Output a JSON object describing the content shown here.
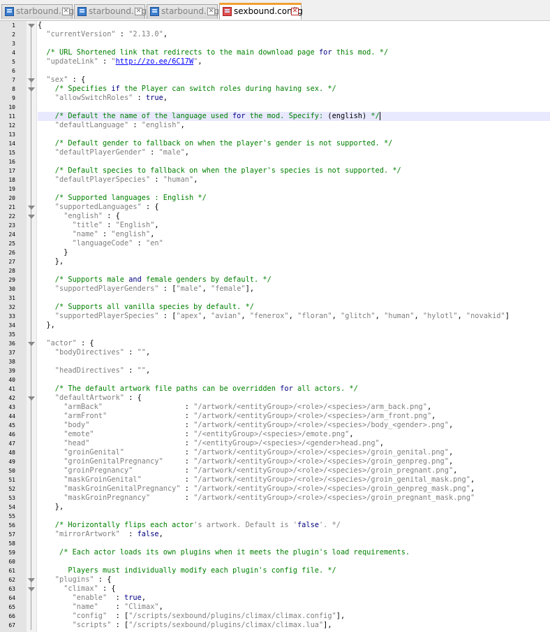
{
  "tabs": [
    {
      "label": "starbound.log",
      "active": false
    },
    {
      "label": "starbound.log",
      "active": false
    },
    {
      "label": "starbound.log",
      "active": false
    },
    {
      "label": "sexbound.config",
      "active": true
    }
  ],
  "close_glyph": "✕",
  "colors": {
    "comment": "#008000",
    "string": "#808080",
    "keyword": "#000080",
    "link": "#0000ff",
    "active_tab_accent": "#f0a030"
  },
  "editor": {
    "current_line": 11,
    "fold_lines": [
      1,
      7,
      8,
      21,
      22,
      36,
      42,
      62,
      63
    ],
    "lines": [
      {
        "n": "1",
        "parts": [
          [
            "pn",
            "{"
          ]
        ]
      },
      {
        "n": "2",
        "parts": [
          [
            "st",
            "  \"currentVersion\""
          ],
          [
            "pn",
            " : "
          ],
          [
            "st",
            "\"2.13.0\""
          ],
          [
            "pn",
            ","
          ]
        ]
      },
      {
        "n": "3",
        "parts": []
      },
      {
        "n": "4",
        "parts": [
          [
            "cm",
            "  /* URL Shortened link that redirects to the main download page "
          ],
          [
            "kw",
            "for"
          ],
          [
            "cm",
            " this mod. */"
          ]
        ]
      },
      {
        "n": "5",
        "parts": [
          [
            "st",
            "  \"updateLink\""
          ],
          [
            "pn",
            " : "
          ],
          [
            "st",
            "\""
          ],
          [
            "lk",
            "http://zo.ee/6C17W"
          ],
          [
            "st",
            "\""
          ],
          [
            "pn",
            ","
          ]
        ]
      },
      {
        "n": "6",
        "parts": []
      },
      {
        "n": "7",
        "parts": [
          [
            "st",
            "  \"sex\""
          ],
          [
            "pn",
            " : {"
          ]
        ]
      },
      {
        "n": "8",
        "parts": [
          [
            "cm",
            "    /* Specifies "
          ],
          [
            "kw",
            "if"
          ],
          [
            "cm",
            " the Player can switch roles during having sex. */"
          ]
        ]
      },
      {
        "n": "9",
        "parts": [
          [
            "st",
            "    \"allowSwitchRoles\""
          ],
          [
            "pn",
            " : "
          ],
          [
            "kw",
            "true"
          ],
          [
            "pn",
            ","
          ]
        ]
      },
      {
        "n": "10",
        "parts": []
      },
      {
        "n": "11",
        "parts": [
          [
            "cm",
            "    /* Default the name of the language used "
          ],
          [
            "kw",
            "for"
          ],
          [
            "cm",
            " the mod. Specify: "
          ],
          [
            "pn",
            "(english)"
          ],
          [
            "cm",
            " */"
          ]
        ]
      },
      {
        "n": "12",
        "parts": [
          [
            "st",
            "    \"defaultLanguage\""
          ],
          [
            "pn",
            " : "
          ],
          [
            "st",
            "\"english\""
          ],
          [
            "pn",
            ","
          ]
        ]
      },
      {
        "n": "13",
        "parts": []
      },
      {
        "n": "14",
        "parts": [
          [
            "cm",
            "    /* Default gender to fallback on when the player's gender is not supported. */"
          ]
        ]
      },
      {
        "n": "15",
        "parts": [
          [
            "st",
            "    \"defaultPlayerGender\""
          ],
          [
            "pn",
            " : "
          ],
          [
            "st",
            "\"male\""
          ],
          [
            "pn",
            ","
          ]
        ]
      },
      {
        "n": "16",
        "parts": []
      },
      {
        "n": "17",
        "parts": [
          [
            "cm",
            "    /* Default species to fallback on when the player's species is not supported. */"
          ]
        ]
      },
      {
        "n": "18",
        "parts": [
          [
            "st",
            "    \"defaultPlayerSpecies\""
          ],
          [
            "pn",
            " : "
          ],
          [
            "st",
            "\"human\""
          ],
          [
            "pn",
            ","
          ]
        ]
      },
      {
        "n": "19",
        "parts": []
      },
      {
        "n": "20",
        "parts": [
          [
            "cm",
            "    /* Supported languages : English */"
          ]
        ]
      },
      {
        "n": "21",
        "parts": [
          [
            "st",
            "    \"supportedLanguages\""
          ],
          [
            "pn",
            " : {"
          ]
        ]
      },
      {
        "n": "22",
        "parts": [
          [
            "st",
            "      \"english\""
          ],
          [
            "pn",
            " : {"
          ]
        ]
      },
      {
        "n": "23",
        "parts": [
          [
            "st",
            "        \"title\""
          ],
          [
            "pn",
            " : "
          ],
          [
            "st",
            "\"English\""
          ],
          [
            "pn",
            ","
          ]
        ]
      },
      {
        "n": "24",
        "parts": [
          [
            "st",
            "        \"name\""
          ],
          [
            "pn",
            " : "
          ],
          [
            "st",
            "\"english\""
          ],
          [
            "pn",
            ","
          ]
        ]
      },
      {
        "n": "25",
        "parts": [
          [
            "st",
            "        \"languageCode\""
          ],
          [
            "pn",
            " : "
          ],
          [
            "st",
            "\"en\""
          ]
        ]
      },
      {
        "n": "26",
        "parts": [
          [
            "pn",
            "      }"
          ]
        ]
      },
      {
        "n": "27",
        "parts": [
          [
            "pn",
            "    },"
          ]
        ]
      },
      {
        "n": "28",
        "parts": []
      },
      {
        "n": "29",
        "parts": [
          [
            "cm",
            "    /* Supports male "
          ],
          [
            "kw",
            "and"
          ],
          [
            "cm",
            " female genders by default. */"
          ]
        ]
      },
      {
        "n": "30",
        "parts": [
          [
            "st",
            "    \"supportedPlayerGenders\""
          ],
          [
            "pn",
            " : ["
          ],
          [
            "st",
            "\"male\""
          ],
          [
            "pn",
            ", "
          ],
          [
            "st",
            "\"female\""
          ],
          [
            "pn",
            "],"
          ]
        ]
      },
      {
        "n": "31",
        "parts": []
      },
      {
        "n": "32",
        "parts": [
          [
            "cm",
            "    /* Supports all vanilla species by default. */"
          ]
        ]
      },
      {
        "n": "33",
        "parts": [
          [
            "st",
            "    \"supportedPlayerSpecies\""
          ],
          [
            "pn",
            " : ["
          ],
          [
            "st",
            "\"apex\""
          ],
          [
            "pn",
            ", "
          ],
          [
            "st",
            "\"avian\""
          ],
          [
            "pn",
            ", "
          ],
          [
            "st",
            "\"fenerox\""
          ],
          [
            "pn",
            ", "
          ],
          [
            "st",
            "\"floran\""
          ],
          [
            "pn",
            ", "
          ],
          [
            "st",
            "\"glitch\""
          ],
          [
            "pn",
            ", "
          ],
          [
            "st",
            "\"human\""
          ],
          [
            "pn",
            ", "
          ],
          [
            "st",
            "\"hylotl\""
          ],
          [
            "pn",
            ", "
          ],
          [
            "st",
            "\"novakid\""
          ],
          [
            "pn",
            "]"
          ]
        ]
      },
      {
        "n": "34",
        "parts": [
          [
            "pn",
            "  },"
          ]
        ]
      },
      {
        "n": "35",
        "parts": []
      },
      {
        "n": "36",
        "parts": [
          [
            "st",
            "  \"actor\""
          ],
          [
            "pn",
            " : {"
          ]
        ]
      },
      {
        "n": "37",
        "parts": [
          [
            "st",
            "    \"bodyDirectives\""
          ],
          [
            "pn",
            " : "
          ],
          [
            "st",
            "\"\""
          ],
          [
            "pn",
            ","
          ]
        ]
      },
      {
        "n": "38",
        "parts": []
      },
      {
        "n": "39",
        "parts": [
          [
            "st",
            "    \"headDirectives\""
          ],
          [
            "pn",
            " : "
          ],
          [
            "st",
            "\"\""
          ],
          [
            "pn",
            ","
          ]
        ]
      },
      {
        "n": "40",
        "parts": []
      },
      {
        "n": "41",
        "parts": [
          [
            "cm",
            "    /* The default artwork file paths can be overridden "
          ],
          [
            "kw",
            "for"
          ],
          [
            "cm",
            " all actors. */"
          ]
        ]
      },
      {
        "n": "42",
        "parts": [
          [
            "st",
            "    \"defaultArtwork\""
          ],
          [
            "pn",
            " : {"
          ]
        ]
      },
      {
        "n": "43",
        "parts": [
          [
            "st",
            "      \"armBack\"                  "
          ],
          [
            "pn",
            " : "
          ],
          [
            "st",
            "\"/artwork/<entityGroup>/<role>/<species>/arm_back.png\""
          ],
          [
            "pn",
            ","
          ]
        ]
      },
      {
        "n": "44",
        "parts": [
          [
            "st",
            "      \"armFront\"                 "
          ],
          [
            "pn",
            " : "
          ],
          [
            "st",
            "\"/artwork/<entityGroup>/<role>/<species>/arm_front.png\""
          ],
          [
            "pn",
            ","
          ]
        ]
      },
      {
        "n": "45",
        "parts": [
          [
            "st",
            "      \"body\"                     "
          ],
          [
            "pn",
            " : "
          ],
          [
            "st",
            "\"/artwork/<entityGroup>/<role>/<species>/body_<gender>.png\""
          ],
          [
            "pn",
            ","
          ]
        ]
      },
      {
        "n": "46",
        "parts": [
          [
            "st",
            "      \"emote\"                    "
          ],
          [
            "pn",
            " : "
          ],
          [
            "st",
            "\"/<entityGroup>/<species>/emote.png\""
          ],
          [
            "pn",
            ","
          ]
        ]
      },
      {
        "n": "47",
        "parts": [
          [
            "st",
            "      \"head\"                     "
          ],
          [
            "pn",
            " : "
          ],
          [
            "st",
            "\"/<entityGroup>/<species>/<gender>head.png\""
          ],
          [
            "pn",
            ","
          ]
        ]
      },
      {
        "n": "48",
        "parts": [
          [
            "st",
            "      \"groinGenital\"             "
          ],
          [
            "pn",
            " : "
          ],
          [
            "st",
            "\"/artwork/<entityGroup>/<role>/<species>/groin_genital.png\""
          ],
          [
            "pn",
            ","
          ]
        ]
      },
      {
        "n": "49",
        "parts": [
          [
            "st",
            "      \"groinGenitalPregnancy\"    "
          ],
          [
            "pn",
            " : "
          ],
          [
            "st",
            "\"/artwork/<entityGroup>/<role>/<species>/groin_genpreg.png\""
          ],
          [
            "pn",
            ","
          ]
        ]
      },
      {
        "n": "50",
        "parts": [
          [
            "st",
            "      \"groinPregnancy\"           "
          ],
          [
            "pn",
            " : "
          ],
          [
            "st",
            "\"/artwork/<entityGroup>/<role>/<species>/groin_pregnant.png\""
          ],
          [
            "pn",
            ","
          ]
        ]
      },
      {
        "n": "51",
        "parts": [
          [
            "st",
            "      \"maskGroinGenital\"         "
          ],
          [
            "pn",
            " : "
          ],
          [
            "st",
            "\"/artwork/<entityGroup>/<role>/<species>/groin_genital_mask.png\""
          ],
          [
            "pn",
            ","
          ]
        ]
      },
      {
        "n": "52",
        "parts": [
          [
            "st",
            "      \"maskGroinGenitalPregnancy\""
          ],
          [
            "pn",
            " : "
          ],
          [
            "st",
            "\"/artwork/<entityGroup>/<role>/<species>/groin_genpreg_mask.png\""
          ],
          [
            "pn",
            ","
          ]
        ]
      },
      {
        "n": "53",
        "parts": [
          [
            "st",
            "      \"maskGroinPregnancy\"       "
          ],
          [
            "pn",
            " : "
          ],
          [
            "st",
            "\"/artwork/<entityGroup>/<role>/<species>/groin_pregnant_mask.png\""
          ]
        ]
      },
      {
        "n": "54",
        "parts": [
          [
            "pn",
            "    },"
          ]
        ]
      },
      {
        "n": "55",
        "parts": []
      },
      {
        "n": "56",
        "parts": [
          [
            "cm",
            "    /* Horizontally flips each actor"
          ],
          [
            "st",
            "'s artwork. Default is '"
          ],
          [
            "kw",
            "false"
          ],
          [
            "st",
            "'. */"
          ]
        ]
      },
      {
        "n": "57",
        "parts": [
          [
            "st",
            "    \"mirrorArtwork\""
          ],
          [
            "pn",
            "  : "
          ],
          [
            "kw",
            "false"
          ],
          [
            "pn",
            ","
          ]
        ]
      },
      {
        "n": "58",
        "parts": []
      },
      {
        "n": "59",
        "parts": [
          [
            "cm",
            "     /* Each actor loads its own plugins when it meets the plugin's load requirements."
          ]
        ]
      },
      {
        "n": "60",
        "parts": []
      },
      {
        "n": "61",
        "parts": [
          [
            "cm",
            "       Players must individually modify each plugin's config file. */"
          ]
        ]
      },
      {
        "n": "62",
        "parts": [
          [
            "st",
            "    \"plugins\""
          ],
          [
            "pn",
            " : {"
          ]
        ]
      },
      {
        "n": "63",
        "parts": [
          [
            "st",
            "      \"climax\""
          ],
          [
            "pn",
            " : {"
          ]
        ]
      },
      {
        "n": "64",
        "parts": [
          [
            "st",
            "        \"enable\""
          ],
          [
            "pn",
            "  : "
          ],
          [
            "kw",
            "true"
          ],
          [
            "pn",
            ","
          ]
        ]
      },
      {
        "n": "65",
        "parts": [
          [
            "st",
            "        \"name\""
          ],
          [
            "pn",
            "    : "
          ],
          [
            "st",
            "\"Climax\""
          ],
          [
            "pn",
            ","
          ]
        ]
      },
      {
        "n": "66",
        "parts": [
          [
            "st",
            "        \"config\""
          ],
          [
            "pn",
            "  : ["
          ],
          [
            "st",
            "\"/scripts/sexbound/plugins/climax/climax.config\""
          ],
          [
            "pn",
            "],"
          ]
        ]
      },
      {
        "n": "67",
        "parts": [
          [
            "st",
            "        \"scripts\""
          ],
          [
            "pn",
            " : ["
          ],
          [
            "st",
            "\"/scripts/sexbound/plugins/climax/climax.lua\""
          ],
          [
            "pn",
            "],"
          ]
        ]
      }
    ]
  }
}
